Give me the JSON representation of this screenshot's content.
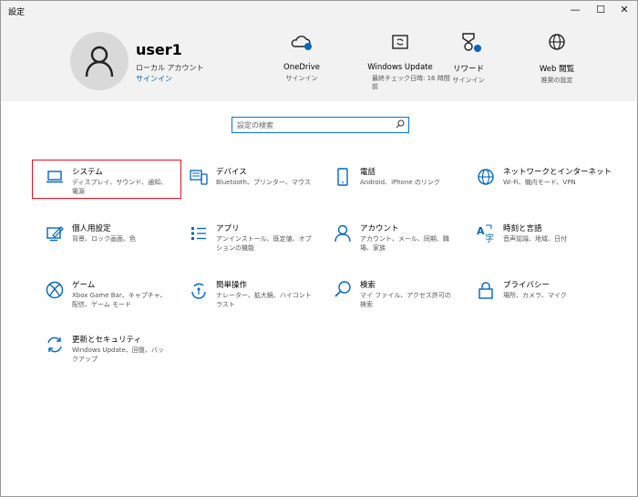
{
  "window": {
    "title": "設定",
    "minimize": "—",
    "maximize": "☐",
    "close": "✕"
  },
  "account": {
    "username": "user1",
    "type": "ローカル アカウント",
    "signin": "サインイン"
  },
  "header_cards": [
    {
      "label": "OneDrive",
      "sub": "サインイン",
      "icon": "onedrive-icon"
    },
    {
      "label": "Windows Update",
      "sub": "最終チェック日時: 16 時間前",
      "icon": "windows-update-icon"
    },
    {
      "label": "リワード",
      "sub": "サインイン",
      "icon": "rewards-icon"
    },
    {
      "label": "Web 閲覧",
      "sub": "推奨の設定",
      "icon": "globe-icon"
    }
  ],
  "search": {
    "placeholder": "設定の検索"
  },
  "tiles": [
    {
      "title": "システム",
      "desc": "ディスプレイ、サウンド、通知、電源",
      "icon": "laptop-icon"
    },
    {
      "title": "デバイス",
      "desc": "Bluetooth、プリンター、マウス",
      "icon": "devices-icon"
    },
    {
      "title": "電話",
      "desc": "Android、iPhone のリンク",
      "icon": "phone-icon"
    },
    {
      "title": "ネットワークとインターネット",
      "desc": "Wi-Fi、機内モード、VPN",
      "icon": "globe-icon"
    },
    {
      "title": "個人用設定",
      "desc": "背景、ロック画面、色",
      "icon": "personalization-icon"
    },
    {
      "title": "アプリ",
      "desc": "アンインストール、既定値、オプションの機能",
      "icon": "apps-icon"
    },
    {
      "title": "アカウント",
      "desc": "アカウント、メール、同期、職場、家族",
      "icon": "person-icon"
    },
    {
      "title": "時刻と言語",
      "desc": "音声認識、地域、日付",
      "icon": "time-language-icon"
    },
    {
      "title": "ゲーム",
      "desc": "Xbox Game Bar、キャプチャ、配信、ゲーム モード",
      "icon": "xbox-icon"
    },
    {
      "title": "簡単操作",
      "desc": "ナレーター、拡大鏡、ハイコントラスト",
      "icon": "ease-of-access-icon"
    },
    {
      "title": "検索",
      "desc": "マイ ファイル、アクセス許可の検索",
      "icon": "search-icon"
    },
    {
      "title": "プライバシー",
      "desc": "場所、カメラ、マイク",
      "icon": "lock-icon"
    },
    {
      "title": "更新とセキュリティ",
      "desc": "Windows Update、回復、バックアップ",
      "icon": "update-security-icon"
    }
  ],
  "colors": {
    "accent": "#0067c0",
    "highlight": "#e81123"
  }
}
